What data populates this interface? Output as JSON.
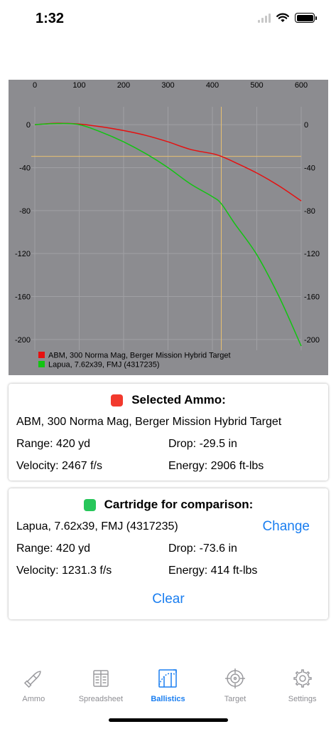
{
  "status_bar": {
    "time": "1:32"
  },
  "chart_data": {
    "type": "line",
    "x_ticks": [
      0,
      100,
      200,
      300,
      400,
      500,
      600
    ],
    "y_ticks": [
      0,
      -40,
      -80,
      -120,
      -160,
      -200
    ],
    "xlim": [
      0,
      600
    ],
    "ylim": [
      -210,
      10
    ],
    "grid": true,
    "legend_placement": "bottom-left",
    "crosshair": {
      "x": 420,
      "y": -29.5
    },
    "series": [
      {
        "name": "ABM, 300 Norma Mag, Berger Mission Hybrid Target",
        "color": "#e61010",
        "x": [
          0,
          50,
          100,
          150,
          200,
          250,
          300,
          350,
          400,
          420,
          450,
          500,
          550,
          600
        ],
        "y": [
          0,
          1.3,
          0.5,
          -2,
          -5.5,
          -10,
          -16,
          -23,
          -27,
          -29.5,
          -35,
          -45,
          -57,
          -71
        ]
      },
      {
        "name": "Lapua, 7.62x39, FMJ (4317235)",
        "color": "#12c412",
        "x": [
          0,
          50,
          100,
          150,
          200,
          250,
          300,
          350,
          400,
          420,
          450,
          500,
          550,
          600
        ],
        "y": [
          0,
          1.0,
          0,
          -7,
          -16,
          -27,
          -40,
          -55,
          -67,
          -73.6,
          -92,
          -121,
          -160,
          -206
        ]
      }
    ]
  },
  "selected": {
    "title": "Selected Ammo:",
    "color": "#f2392d",
    "ammo": "ABM, 300 Norma Mag, Berger Mission Hybrid Target",
    "range": "Range: 420 yd",
    "drop": "Drop: -29.5 in",
    "velocity": "Velocity: 2467 f/s",
    "energy": "Energy: 2906 ft-lbs"
  },
  "comparison": {
    "title": "Cartridge for comparison:",
    "color": "#27c65a",
    "ammo": "Lapua, 7.62x39, FMJ (4317235)",
    "change_label": "Change",
    "range": "Range: 420 yd",
    "drop": "Drop: -73.6 in",
    "velocity": "Velocity: 1231.3 f/s",
    "energy": "Energy: 414 ft-lbs",
    "clear_label": "Clear"
  },
  "tabs": [
    {
      "label": "Ammo",
      "icon": "bullet-icon",
      "active": false
    },
    {
      "label": "Spreadsheet",
      "icon": "spreadsheet-icon",
      "active": false
    },
    {
      "label": "Ballistics",
      "icon": "trajectory-icon",
      "active": true
    },
    {
      "label": "Target",
      "icon": "crosshair-icon",
      "active": false
    },
    {
      "label": "Settings",
      "icon": "gear-icon",
      "active": false
    }
  ]
}
